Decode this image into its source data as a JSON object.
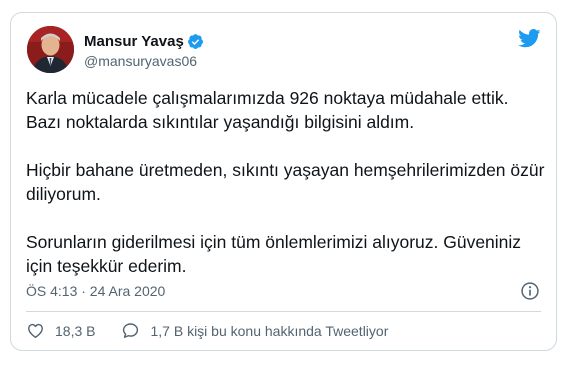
{
  "tweet": {
    "author": {
      "name": "Mansur Yavaş",
      "handle": "@mansuryavas06"
    },
    "paragraphs": [
      "Karla mücadele çalışmalarımızda 926 noktaya müdahale ettik. Bazı noktalarda sıkıntılar yaşandığı bilgisini aldım.",
      "Hiçbir bahane üretmeden, sıkıntı yaşayan hemşehrilerimizden özür diliyorum.",
      "Sorunların giderilmesi için tüm önlemlerimizi alıyoruz. Güveniniz için teşekkür ederim."
    ],
    "timestamp": "ÖS 4:13 · 24 Ara 2020",
    "likes": "18,3 B",
    "replies": "1,7 B kişi bu konu hakkında Tweetliyor"
  },
  "icons": {
    "verified": "verified-badge-icon",
    "brand": "twitter-bird-icon",
    "info": "info-icon",
    "like": "heart-icon",
    "reply": "reply-bubble-icon"
  },
  "colors": {
    "accent": "#1d9bf0",
    "text": "#0f1419",
    "secondary": "#536471",
    "border": "#cfd9de"
  }
}
